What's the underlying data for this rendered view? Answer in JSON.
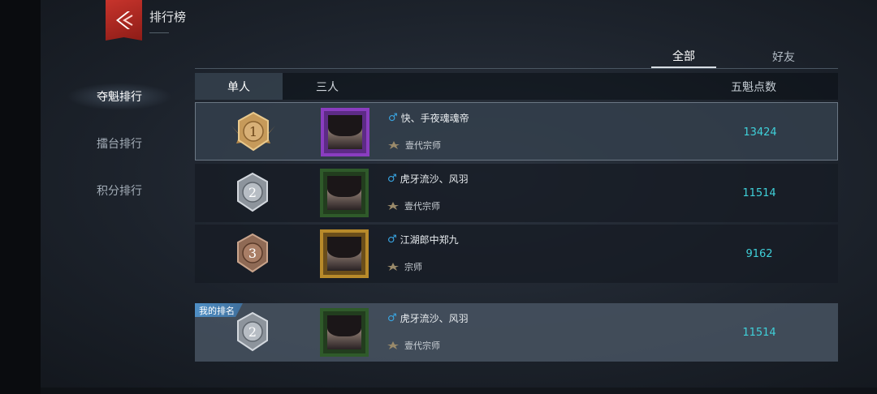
{
  "page": {
    "title": "排行榜"
  },
  "sidenav": {
    "items": [
      "夺魁排行",
      "擂台排行",
      "积分排行"
    ],
    "active": 0
  },
  "filter_tabs": {
    "items": [
      "全部",
      "好友"
    ],
    "active": 0
  },
  "table": {
    "tabs": [
      "单人",
      "三人"
    ],
    "score_header": "五魁点数"
  },
  "rows": [
    {
      "rank": "1",
      "medal": "gold-medal-icon",
      "name": "快、手夜魂魂帝",
      "title": "壹代宗师",
      "score": "13424",
      "frame": "purple"
    },
    {
      "rank": "2",
      "medal": "silver-medal-icon",
      "name": "虎牙流沙、风羽",
      "title": "壹代宗师",
      "score": "11514",
      "frame": "green"
    },
    {
      "rank": "3",
      "medal": "bronze-medal-icon",
      "name": "江湖郎中郑九",
      "title": "宗师",
      "score": "9162",
      "frame": "gold"
    }
  ],
  "my_rank": {
    "label": "我的排名",
    "rank": "2",
    "name": "虎牙流沙、风羽",
    "title": "壹代宗师",
    "score": "11514"
  },
  "colors": {
    "score": "#3fd0d9",
    "gender": "#39a6e3",
    "accent": "#c7342c"
  }
}
